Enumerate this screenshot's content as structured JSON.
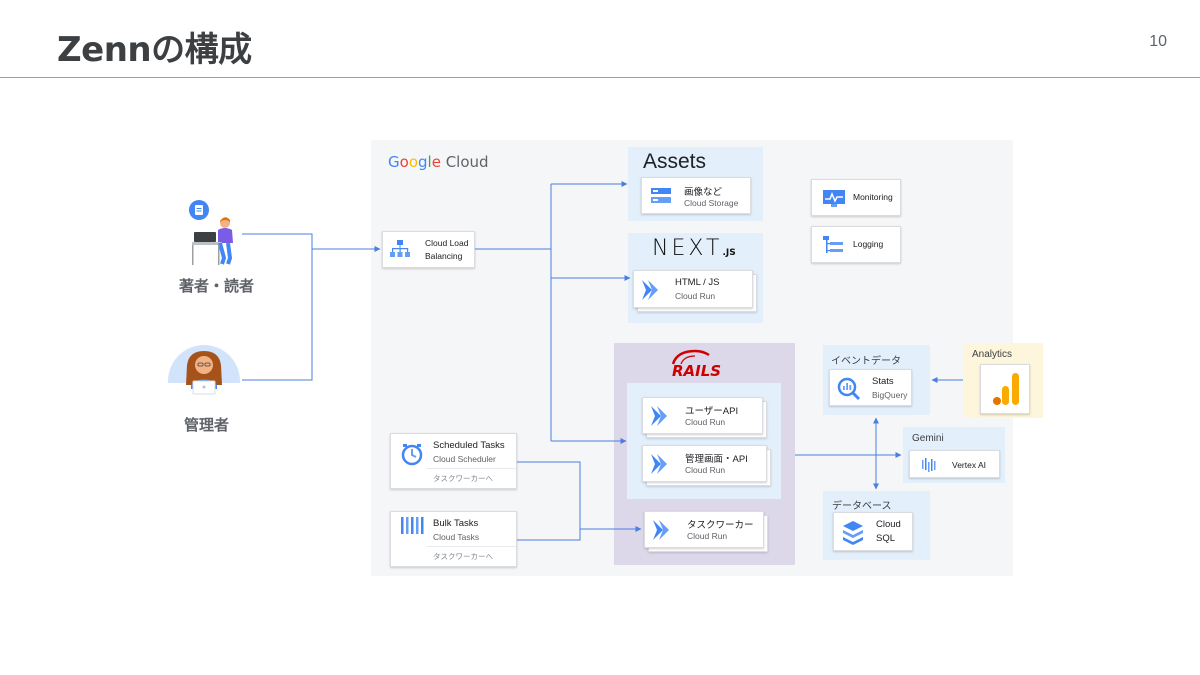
{
  "slide": {
    "title": "Zennの構成",
    "page_number": "10"
  },
  "gcp_logo": {
    "g1": "G",
    "g2": "o",
    "g3": "o",
    "g4": "g",
    "g5": "l",
    "g6": "e",
    "cloud": " Cloud"
  },
  "actors": {
    "writer_reader": "著者・読者",
    "admin": "管理者"
  },
  "load_balancer": {
    "name_line1": "Cloud Load",
    "name_line2": "Balancing"
  },
  "assets": {
    "title": "Assets",
    "card": {
      "name": "画像など",
      "sub": "Cloud Storage"
    }
  },
  "nextjs": {
    "logo_main": "NEXT",
    "logo_suffix": ".JS",
    "card": {
      "name": "HTML / JS",
      "sub": "Cloud Run"
    }
  },
  "monitoring": {
    "name": "Monitoring"
  },
  "logging": {
    "name": "Logging"
  },
  "rails": {
    "logo": "RAILS",
    "user_api": {
      "name": "ユーザーAPI",
      "sub": "Cloud Run"
    },
    "admin_api": {
      "name": "管理画面・API",
      "sub": "Cloud Run"
    },
    "task_worker": {
      "name": "タスクワーカー",
      "sub": "Cloud Run"
    }
  },
  "scheduled_tasks": {
    "name": "Scheduled Tasks",
    "sub": "Cloud Scheduler",
    "foot": "タスクワーカーへ"
  },
  "bulk_tasks": {
    "name": "Bulk Tasks",
    "sub": "Cloud Tasks",
    "foot": "タスクワーカーへ"
  },
  "event_data": {
    "label": "イベントデータ",
    "card": {
      "name": "Stats",
      "sub": "BigQuery"
    }
  },
  "analytics": {
    "label": "Analytics"
  },
  "gemini": {
    "label": "Gemini",
    "card": {
      "name": "Vertex AI"
    }
  },
  "database": {
    "label": "データベース",
    "card": {
      "name_line1": "Cloud",
      "name_line2": "SQL"
    }
  },
  "colors": {
    "google_blue": "#4285f4",
    "arrow": "#4a7fe0",
    "rails_red": "#cc0000",
    "analytics_orange": "#f9ab00"
  }
}
